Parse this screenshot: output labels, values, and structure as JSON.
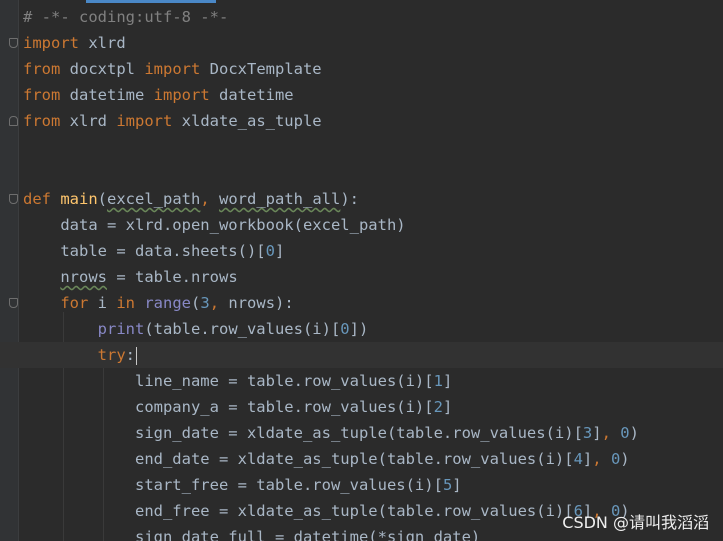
{
  "editor": {
    "lines": [
      {
        "segments": [
          {
            "text": "# -*- coding:utf-8 -*-",
            "cls": "cmt"
          }
        ]
      },
      {
        "segments": [
          {
            "text": "import",
            "cls": "kw"
          },
          {
            "text": " xlrd"
          }
        ]
      },
      {
        "segments": [
          {
            "text": "from",
            "cls": "kw"
          },
          {
            "text": " docxtpl "
          },
          {
            "text": "import",
            "cls": "kw"
          },
          {
            "text": " DocxTemplate"
          }
        ]
      },
      {
        "segments": [
          {
            "text": "from",
            "cls": "kw"
          },
          {
            "text": " datetime "
          },
          {
            "text": "import",
            "cls": "kw"
          },
          {
            "text": " datetime"
          }
        ]
      },
      {
        "segments": [
          {
            "text": "from",
            "cls": "kw"
          },
          {
            "text": " xlrd "
          },
          {
            "text": "import",
            "cls": "kw"
          },
          {
            "text": " xldate_as_tuple"
          }
        ]
      },
      {
        "segments": []
      },
      {
        "segments": []
      },
      {
        "segments": [
          {
            "text": "def",
            "cls": "kw"
          },
          {
            "text": " "
          },
          {
            "text": "main",
            "cls": "fn"
          },
          {
            "text": "("
          },
          {
            "text": "excel_path",
            "cls": "param"
          },
          {
            "text": ", ",
            "cls": "kw"
          },
          {
            "text": "word_path_all",
            "cls": "param"
          },
          {
            "text": "):"
          }
        ]
      },
      {
        "segments": [
          {
            "text": "    data = xlrd.open_workbook(excel_path)"
          }
        ]
      },
      {
        "segments": [
          {
            "text": "    table = data.sheets()["
          },
          {
            "text": "0",
            "cls": "num"
          },
          {
            "text": "]"
          }
        ]
      },
      {
        "segments": [
          {
            "text": "    "
          },
          {
            "text": "nrows",
            "cls": "typo"
          },
          {
            "text": " = table.nrows"
          }
        ]
      },
      {
        "segments": [
          {
            "text": "    "
          },
          {
            "text": "for",
            "cls": "kw"
          },
          {
            "text": " i "
          },
          {
            "text": "in",
            "cls": "kw"
          },
          {
            "text": " "
          },
          {
            "text": "range",
            "cls": "builtin"
          },
          {
            "text": "("
          },
          {
            "text": "3",
            "cls": "num"
          },
          {
            "text": ", ",
            "cls": "kw"
          },
          {
            "text": "nrows):"
          }
        ]
      },
      {
        "segments": [
          {
            "text": "        "
          },
          {
            "text": "print",
            "cls": "builtin"
          },
          {
            "text": "(table.row_values(i)["
          },
          {
            "text": "0",
            "cls": "num"
          },
          {
            "text": "])"
          }
        ]
      },
      {
        "segments": [
          {
            "text": "        "
          },
          {
            "text": "try",
            "cls": "kw"
          },
          {
            "text": ":"
          }
        ],
        "caret": true,
        "active": true
      },
      {
        "segments": [
          {
            "text": "            line_name = table.row_values(i)["
          },
          {
            "text": "1",
            "cls": "num"
          },
          {
            "text": "]"
          }
        ]
      },
      {
        "segments": [
          {
            "text": "            company_a = table.row_values(i)["
          },
          {
            "text": "2",
            "cls": "num"
          },
          {
            "text": "]"
          }
        ]
      },
      {
        "segments": [
          {
            "text": "            sign_date = xldate_as_tuple(table.row_values(i)["
          },
          {
            "text": "3",
            "cls": "num"
          },
          {
            "text": "]"
          },
          {
            "text": ", ",
            "cls": "kw"
          },
          {
            "text": "0",
            "cls": "num"
          },
          {
            "text": ")"
          }
        ]
      },
      {
        "segments": [
          {
            "text": "            end_date = xldate_as_tuple(table.row_values(i)["
          },
          {
            "text": "4",
            "cls": "num"
          },
          {
            "text": "]"
          },
          {
            "text": ", ",
            "cls": "kw"
          },
          {
            "text": "0",
            "cls": "num"
          },
          {
            "text": ")"
          }
        ]
      },
      {
        "segments": [
          {
            "text": "            start_free = table.row_values(i)["
          },
          {
            "text": "5",
            "cls": "num"
          },
          {
            "text": "]"
          }
        ]
      },
      {
        "segments": [
          {
            "text": "            end_free = xldate_as_tuple(table.row_values(i)["
          },
          {
            "text": "6",
            "cls": "num"
          },
          {
            "text": "]"
          },
          {
            "text": ", ",
            "cls": "kw"
          },
          {
            "text": "0",
            "cls": "num"
          },
          {
            "text": ")"
          }
        ]
      },
      {
        "segments": [
          {
            "text": "            sign_date_full = datetime(*sign_date)"
          }
        ]
      }
    ]
  },
  "watermark": {
    "text": "CSDN @请叫我滔滔"
  },
  "colors": {
    "background": "#2b2b2b",
    "keyword": "#cc7832",
    "function": "#ffc66d",
    "number": "#6897bb",
    "builtin": "#8888c6",
    "comment": "#808080",
    "text": "#a9b7c6"
  }
}
